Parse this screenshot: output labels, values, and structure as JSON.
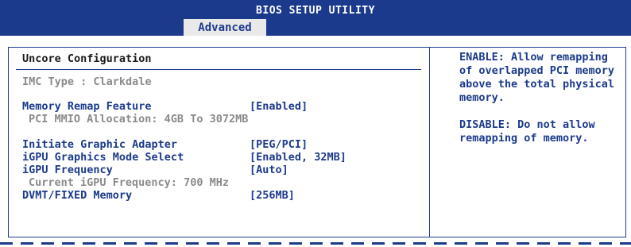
{
  "header": {
    "title": "BIOS SETUP UTILITY",
    "active_tab": "Advanced"
  },
  "left": {
    "section_title": "Uncore Configuration",
    "imc_type": "IMC Type : Clarkdale",
    "memory_remap": {
      "label": "Memory Remap Feature",
      "value": "[Enabled]"
    },
    "pci_mmio": "PCI MMIO Allocation: 4GB To 3072MB",
    "initiate_graphic": {
      "label": "Initiate Graphic Adapter",
      "value": "[PEG/PCI]"
    },
    "igpu_mode": {
      "label": "iGPU Graphics Mode Select",
      "value": "[Enabled, 32MB]"
    },
    "igpu_freq": {
      "label": "iGPU Frequency",
      "value": "[Auto]"
    },
    "current_igpu_freq": "Current iGPU Frequency: 700 MHz",
    "dvmt": {
      "label": "DVMT/FIXED Memory",
      "value": "[256MB]"
    }
  },
  "help": {
    "enable": "ENABLE: Allow remapping of overlapped PCI memory above the total physical memory.",
    "disable": "DISABLE: Do not allow remapping of memory."
  },
  "colors": {
    "accent": "#1c3a8c",
    "disabled_text": "#8a8a8a",
    "tab_background": "#e9e9e9"
  }
}
